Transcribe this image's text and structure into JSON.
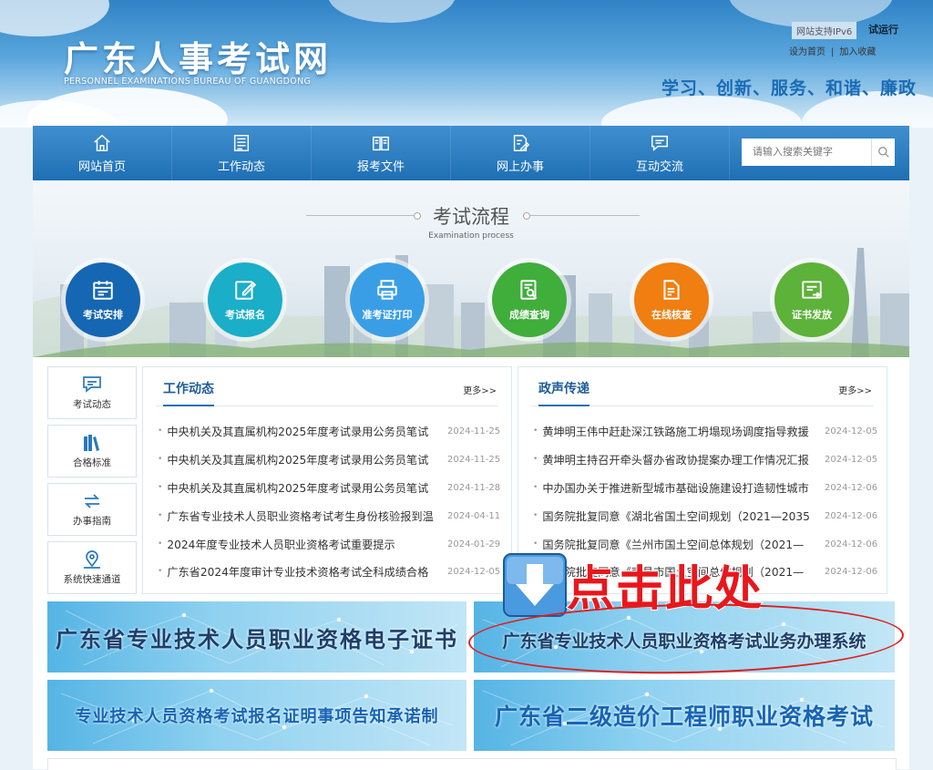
{
  "header": {
    "title": "广东人事考试网",
    "subtitle": "PERSONNEL EXAMINATIONS BUREAU OF GUANGDONG",
    "ipv6_badge": "网站支持IPv6",
    "trial": "试运行",
    "set_home": "设为首页",
    "separator": "|",
    "bookmark": "加入收藏",
    "slogan": "学习、创新、服务、和谐、廉政"
  },
  "nav": {
    "items": [
      {
        "label": "网站首页",
        "icon": "home-icon"
      },
      {
        "label": "工作动态",
        "icon": "newspaper-icon"
      },
      {
        "label": "报考文件",
        "icon": "book-icon"
      },
      {
        "label": "网上办事",
        "icon": "edit-document-icon"
      },
      {
        "label": "互动交流",
        "icon": "chat-icon"
      }
    ],
    "search_placeholder": "请输入搜索关键字"
  },
  "process": {
    "title": "考试流程",
    "subtitle": "Examination process",
    "steps": [
      {
        "label": "考试安排",
        "color": "#1566b3",
        "icon": "calendar-icon"
      },
      {
        "label": "考试报名",
        "color": "#1aaec9",
        "icon": "signup-edit-icon"
      },
      {
        "label": "准考证打印",
        "color": "#3a9ee6",
        "icon": "printer-icon"
      },
      {
        "label": "成绩查询",
        "color": "#3fae3b",
        "icon": "search-document-icon"
      },
      {
        "label": "在线核查",
        "color": "#f07e10",
        "icon": "verify-document-icon"
      },
      {
        "label": "证书发放",
        "color": "#5db239",
        "icon": "certificate-icon"
      }
    ]
  },
  "sidebar": {
    "items": [
      {
        "label": "考试动态",
        "icon": "chat-bubble-icon"
      },
      {
        "label": "合格标准",
        "icon": "books-icon"
      },
      {
        "label": "办事指南",
        "icon": "arrows-exchange-icon"
      },
      {
        "label": "系统快速通道",
        "icon": "location-pin-icon"
      }
    ]
  },
  "work_news": {
    "title": "工作动态",
    "more": "更多>>",
    "items": [
      {
        "title": "中央机关及其直属机构2025年度考试录用公务员笔试",
        "date": "2024-11-25"
      },
      {
        "title": "中央机关及其直属机构2025年度考试录用公务员笔试",
        "date": "2024-11-25"
      },
      {
        "title": "中央机关及其直属机构2025年度考试录用公务员笔试",
        "date": "2024-11-28"
      },
      {
        "title": "广东省专业技术人员职业资格考试考生身份核验报到温",
        "date": "2024-04-11"
      },
      {
        "title": "2024年度专业技术人员职业资格考试重要提示",
        "date": "2024-01-29"
      },
      {
        "title": "广东省2024年度审计专业技术资格考试全科成绩合格",
        "date": "2024-12-05"
      }
    ]
  },
  "gov_news": {
    "title": "政声传递",
    "more": "更多>>",
    "items": [
      {
        "title": "黄坤明王伟中赶赴深江铁路施工坍塌现场调度指导救援",
        "date": "2024-12-05"
      },
      {
        "title": "黄坤明主持召开牵头督办省政协提案办理工作情况汇报",
        "date": "2024-12-05"
      },
      {
        "title": "中办国办关于推进新型城市基础设施建设打造韧性城市",
        "date": "2024-12-06"
      },
      {
        "title": "国务院批复同意《湖北省国土空间规划（2021—2035",
        "date": "2024-12-06"
      },
      {
        "title": "国务院批复同意《兰州市国土空间总体规划（2021—",
        "date": "2024-12-06"
      },
      {
        "title": "国务院批复同意《南昌市国土空间总体规划（2021—",
        "date": "2024-12-06"
      }
    ]
  },
  "banners": {
    "cert_system": "广东省专业技术人员职业资格电子证书",
    "business_system": "广东省专业技术人员职业资格考试业务办理系统",
    "commitment": "专业技术人员资格考试报名证明事项告知承诺制",
    "cost_engineer": "广东省二级造价工程师职业资格考试"
  },
  "overlay": {
    "click_here": "点击此处",
    "arrow_icon": "down-arrow-icon",
    "ellipse_color": "#e21c1c"
  }
}
